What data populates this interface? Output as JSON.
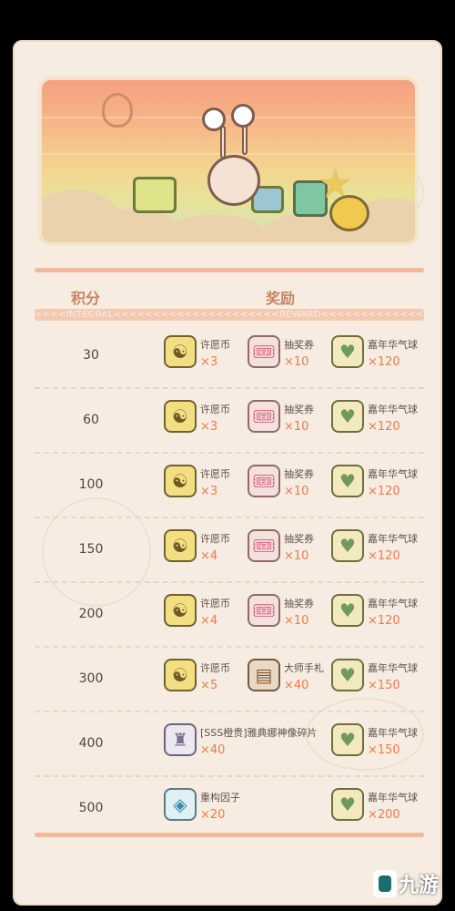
{
  "header": {
    "col_score": "积分",
    "col_reward": "奖励",
    "sub_strip": "<<<<INTEGRAL<<<<<<<<<<<<<<<<<<<<<REWARD<<<<<<<<<<<<<<<<<<<<<<<"
  },
  "rows": [
    {
      "score": "30",
      "items": [
        {
          "name": "许愿币",
          "qty": "×3",
          "icon": "wish-coin-icon",
          "glyph": "☯"
        },
        {
          "name": "抽奖券",
          "qty": "×10",
          "icon": "lottery-ticket-icon",
          "glyph": "🎟"
        },
        {
          "name": "嘉年华气球",
          "qty": "×120",
          "icon": "carnival-balloon-icon",
          "glyph": "♥"
        }
      ]
    },
    {
      "score": "60",
      "items": [
        {
          "name": "许愿币",
          "qty": "×3",
          "icon": "wish-coin-icon",
          "glyph": "☯"
        },
        {
          "name": "抽奖券",
          "qty": "×10",
          "icon": "lottery-ticket-icon",
          "glyph": "🎟"
        },
        {
          "name": "嘉年华气球",
          "qty": "×120",
          "icon": "carnival-balloon-icon",
          "glyph": "♥"
        }
      ]
    },
    {
      "score": "100",
      "items": [
        {
          "name": "许愿币",
          "qty": "×3",
          "icon": "wish-coin-icon",
          "glyph": "☯"
        },
        {
          "name": "抽奖券",
          "qty": "×10",
          "icon": "lottery-ticket-icon",
          "glyph": "🎟"
        },
        {
          "name": "嘉年华气球",
          "qty": "×120",
          "icon": "carnival-balloon-icon",
          "glyph": "♥"
        }
      ]
    },
    {
      "score": "150",
      "items": [
        {
          "name": "许愿币",
          "qty": "×4",
          "icon": "wish-coin-icon",
          "glyph": "☯"
        },
        {
          "name": "抽奖券",
          "qty": "×10",
          "icon": "lottery-ticket-icon",
          "glyph": "🎟"
        },
        {
          "name": "嘉年华气球",
          "qty": "×120",
          "icon": "carnival-balloon-icon",
          "glyph": "♥"
        }
      ]
    },
    {
      "score": "200",
      "items": [
        {
          "name": "许愿币",
          "qty": "×4",
          "icon": "wish-coin-icon",
          "glyph": "☯"
        },
        {
          "name": "抽奖券",
          "qty": "×10",
          "icon": "lottery-ticket-icon",
          "glyph": "🎟"
        },
        {
          "name": "嘉年华气球",
          "qty": "×120",
          "icon": "carnival-balloon-icon",
          "glyph": "♥"
        }
      ]
    },
    {
      "score": "300",
      "items": [
        {
          "name": "许愿币",
          "qty": "×5",
          "icon": "wish-coin-icon",
          "glyph": "☯"
        },
        {
          "name": "大师手札",
          "qty": "×40",
          "icon": "master-notes-icon",
          "glyph": "▤"
        },
        {
          "name": "嘉年华气球",
          "qty": "×150",
          "icon": "carnival-balloon-icon",
          "glyph": "♥"
        }
      ]
    },
    {
      "score": "400",
      "items": [
        {
          "name": "[SSS橙贵]雅典娜神像碎片",
          "qty": "×40",
          "icon": "athena-statue-shard-icon",
          "glyph": "♜"
        },
        {
          "name": "嘉年华气球",
          "qty": "×150",
          "icon": "carnival-balloon-icon",
          "glyph": "♥"
        }
      ]
    },
    {
      "score": "500",
      "items": [
        {
          "name": "重构因子",
          "qty": "×20",
          "icon": "reconstruction-factor-icon",
          "glyph": "◈"
        },
        {
          "name": "嘉年华气球",
          "qty": "×200",
          "icon": "carnival-balloon-icon",
          "glyph": "♥"
        }
      ]
    }
  ],
  "watermark": {
    "text": "九游"
  }
}
